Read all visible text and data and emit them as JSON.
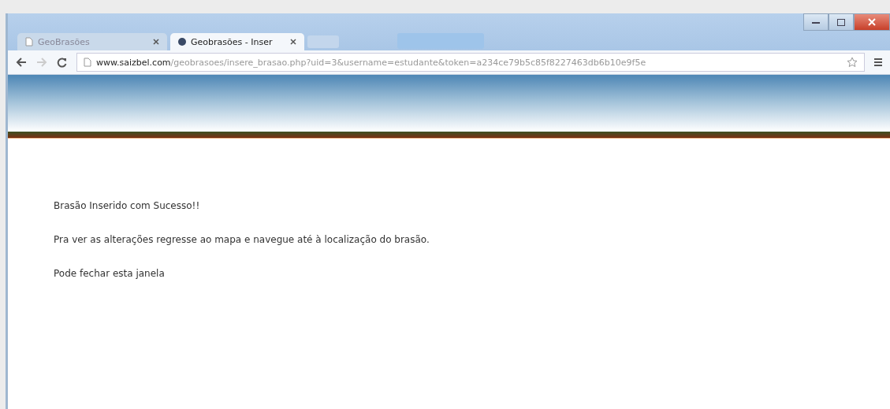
{
  "tabs": [
    {
      "label": "GeoBrasões",
      "selected": false
    },
    {
      "label": "Geobrasões - Inser",
      "selected": true
    }
  ],
  "address_bar": {
    "host": "www.saizbel.com",
    "path": "/geobrasoes/insere_brasao.php?uid=3&username=estudante&token=a234ce79b5c85f8227463db6b10e9f5e"
  },
  "messages": [
    "Brasão Inserido com Sucesso!!",
    "Pra ver as alterações regresse ao mapa e navegue até à localização do brasão.",
    "Pode fechar esta janela"
  ]
}
